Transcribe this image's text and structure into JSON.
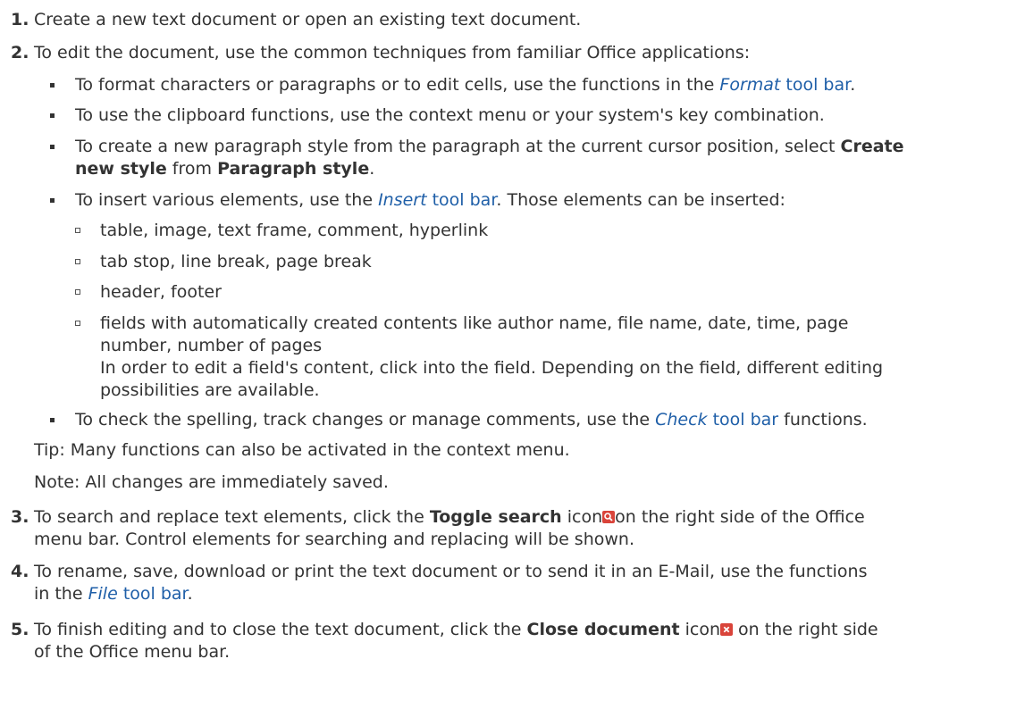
{
  "steps": [
    {
      "number": "1.",
      "text": "Create a new text document or open an existing text document."
    },
    {
      "number": "2.",
      "text": "To edit the document, use the common techniques from familiar Office applications:"
    },
    {
      "number": "3.",
      "pre": "To search and replace text elements, click the ",
      "bold": "Toggle search",
      "mid": " icon",
      "post_line1": "on the right side of the Office",
      "post_line2": "menu bar. Control elements for searching and replacing will be shown."
    },
    {
      "number": "4.",
      "line1": "To rename, save, download or print the text document or to send it in an E-Mail, use the functions",
      "line2_pre": "in the ",
      "link_em": "File",
      "link_rest": " tool bar",
      "line2_post": "."
    },
    {
      "number": "5.",
      "pre": "To finish editing and to close the text document, click the ",
      "bold": "Close document",
      "mid": " icon",
      "post": " on the right side",
      "line2": "of the Office menu bar."
    }
  ],
  "bullets": {
    "format": {
      "pre": "To format characters or paragraphs or to edit cells, use the functions in the ",
      "link_em": "Format",
      "link_rest": " tool bar",
      "post": "."
    },
    "clipboard": {
      "text": "To use the clipboard functions, use the context menu or your system's key combination."
    },
    "style": {
      "pre": "To create a new paragraph style from the paragraph at the current cursor position, select ",
      "bold1": "Create",
      "bold1b": "new style",
      "mid": " from ",
      "bold2": "Paragraph style",
      "post": "."
    },
    "insert": {
      "pre": "To insert various elements, use the ",
      "link_em": "Insert",
      "link_rest": " tool bar",
      "post": ". Those elements can be inserted:"
    },
    "check": {
      "pre": "To check the spelling, track changes or manage comments, use the ",
      "link_em": "Check",
      "link_rest": " tool bar",
      "post": " functions."
    }
  },
  "insert_items": [
    "table, image, text frame, comment, hyperlink",
    "tab stop, line break, page break",
    "header, footer"
  ],
  "fields_item": {
    "line1": "fields with automatically created contents like author name, file name, date, time, page",
    "line2": "number, number of pages",
    "line3": "In order to edit a field's content, click into the field. Depending on the field, different editing",
    "line4": "possibilities are available."
  },
  "tip": "Tip: Many functions can also be activated in the context menu.",
  "note": "Note: All changes are immediately saved.",
  "icons": {
    "search": "search-icon",
    "close": "close-icon",
    "accent": "#d9443a",
    "link_color": "#1f5fa8"
  }
}
